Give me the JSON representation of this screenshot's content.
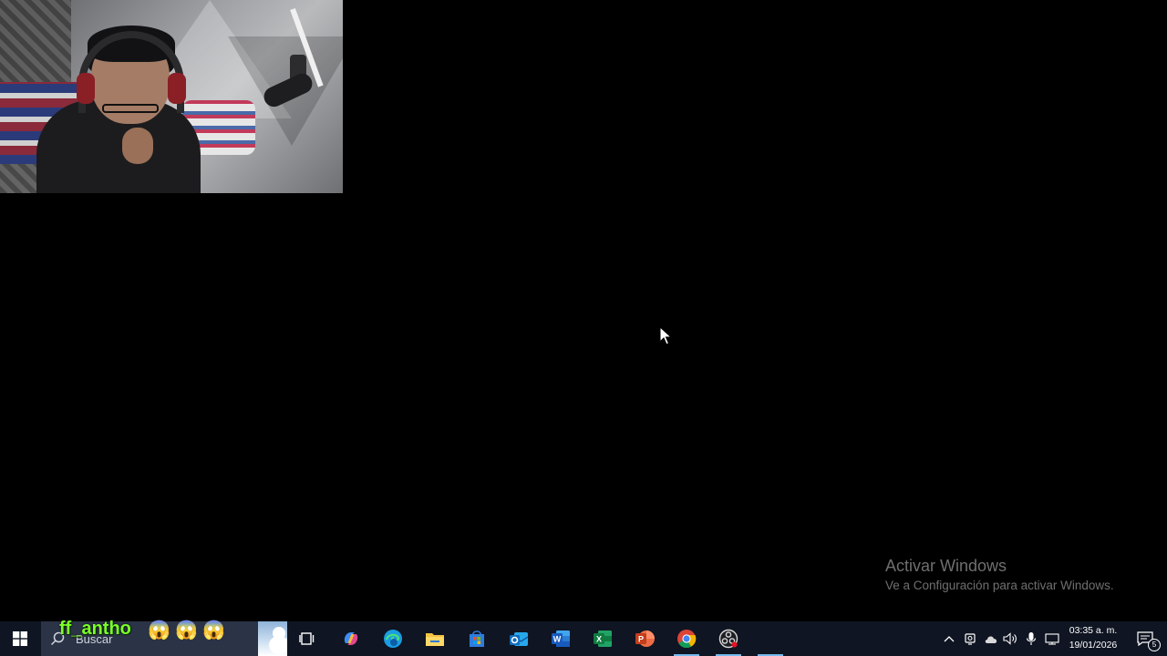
{
  "overlay": {
    "username": "ff_antho",
    "emojis": [
      "😱",
      "😱",
      "😱"
    ]
  },
  "watermark": {
    "title": "Activar Windows",
    "subtitle": "Ve a Configuración para activar Windows."
  },
  "taskbar": {
    "search_placeholder": "Buscar",
    "apps": [
      {
        "name": "task-view",
        "icon": "task-view-icon"
      },
      {
        "name": "copilot",
        "icon": "copilot-icon"
      },
      {
        "name": "edge",
        "icon": "edge-icon"
      },
      {
        "name": "file-explorer",
        "icon": "folder-icon"
      },
      {
        "name": "microsoft-store",
        "icon": "store-icon"
      },
      {
        "name": "outlook",
        "icon": "outlook-icon"
      },
      {
        "name": "word",
        "icon": "word-icon"
      },
      {
        "name": "excel",
        "icon": "excel-icon"
      },
      {
        "name": "powerpoint",
        "icon": "powerpoint-icon"
      },
      {
        "name": "chrome",
        "icon": "chrome-icon",
        "active": true
      },
      {
        "name": "obs",
        "icon": "obs-icon",
        "active": true
      }
    ],
    "clock": {
      "time": "03:35 a. m.",
      "date": "19/01/2026"
    },
    "notification_count": "5"
  },
  "colors": {
    "taskbar_bg": "#0f1522",
    "search_bg": "#2b3346",
    "username_color": "#7cff2a",
    "accent": "#76b9ed"
  }
}
